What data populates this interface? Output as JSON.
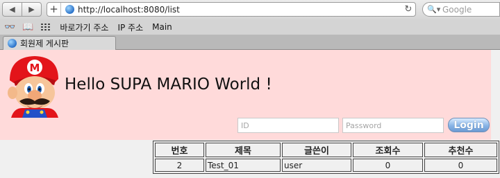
{
  "browser": {
    "url": "http://localhost:8080/list",
    "search_placeholder": "Google",
    "bookmarks": [
      "바로가기 주소",
      "IP 주소",
      "Main"
    ],
    "tab_title": "회원제 게시판"
  },
  "header": {
    "greeting": "Hello SUPA MARIO World !",
    "id_placeholder": "ID",
    "password_placeholder": "Password",
    "login_label": "Login"
  },
  "board": {
    "columns": [
      "번호",
      "제목",
      "글쓴이",
      "조회수",
      "추천수"
    ],
    "rows": [
      [
        "2",
        "Test_01",
        "user",
        "0",
        "0"
      ]
    ]
  },
  "colors": {
    "header_bg": "#ffdada",
    "login_button": "#88b4e6"
  }
}
